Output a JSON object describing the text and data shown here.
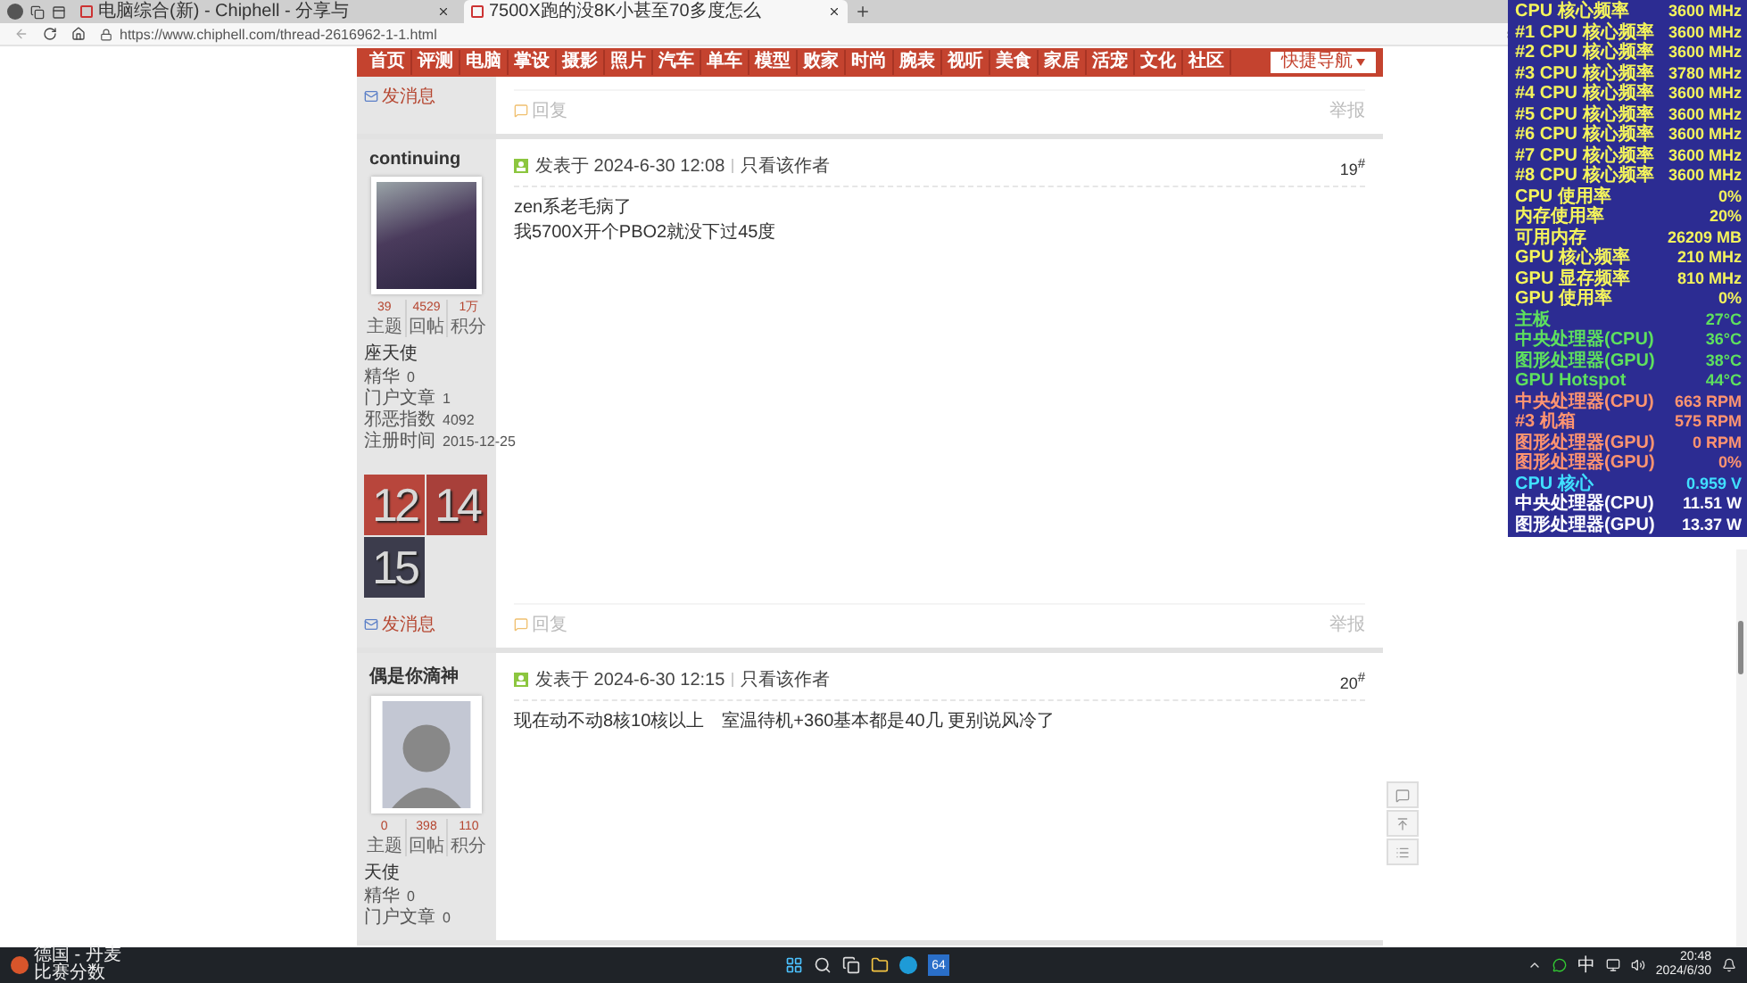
{
  "browser": {
    "tabs": [
      {
        "title": "电脑综合(新) - Chiphell - 分享与",
        "selected": false
      },
      {
        "title": "7500X跑的没8K小甚至70多度怎么",
        "selected": true
      }
    ],
    "url": "https://www.chiphell.com/thread-2616962-1-1.html"
  },
  "nav": {
    "items": [
      "首页",
      "评测",
      "电脑",
      "掌设",
      "摄影",
      "照片",
      "汽车",
      "单车",
      "模型",
      "败家",
      "时尚",
      "腕表",
      "视听",
      "美食",
      "家居",
      "活宠",
      "文化",
      "社区"
    ],
    "quick_nav": "快捷导航"
  },
  "previous_post": {
    "message_link": "发消息",
    "reply": "回复",
    "report": "举报"
  },
  "posts": [
    {
      "author": "continuing",
      "avatar": {
        "kind": "photo"
      },
      "stats": [
        {
          "value": "39",
          "label": "主题"
        },
        {
          "value": "4529",
          "label": "回帖"
        },
        {
          "value": "1万",
          "label": "积分"
        }
      ],
      "rank": "座天使",
      "info": [
        {
          "label": "精华",
          "value": "0"
        },
        {
          "label": "门户文章",
          "value": "1"
        },
        {
          "label": "邪恶指数",
          "value": "4092"
        },
        {
          "label": "注册时间",
          "value": "2015-12-25"
        }
      ],
      "medals": [
        {
          "text": "12",
          "color": "#b8463c"
        },
        {
          "text": "14",
          "color": "#a8403a"
        },
        {
          "text": "15",
          "color": "#3c3c4c"
        }
      ],
      "message_link": "发消息",
      "posted": "发表于 2024-6-30 12:08",
      "only_author": "只看该作者",
      "floor": "19$^{#}$",
      "content": [
        "zen系老毛病了",
        "我5700X开个PBO2就没下过45度"
      ],
      "reply": "回复",
      "report": "举报"
    },
    {
      "author": "偶是你滴神",
      "avatar": {
        "kind": "cartoon"
      },
      "stats": [
        {
          "value": "0",
          "label": "主题"
        },
        {
          "value": "398",
          "label": "回帖"
        },
        {
          "value": "110",
          "label": "积分"
        }
      ],
      "rank": "天使",
      "info": [
        {
          "label": "精华",
          "value": "0"
        },
        {
          "label": "门户文章",
          "value": "0"
        }
      ],
      "posted": "发表于 2024-6-30 12:15",
      "only_author": "只看该作者",
      "floor": "20$^{#}$",
      "content": [
        "现在动不动8核10核以上　室温待机+360基本都是40几 更别说风冷了"
      ]
    }
  ],
  "monitor": [
    {
      "label": "CPU 核心频率",
      "value": "3600 MHz",
      "color": "#f4f45c"
    },
    {
      "label": "#1 CPU 核心频率",
      "value": "3600 MHz",
      "color": "#f4f45c"
    },
    {
      "label": "#2 CPU 核心频率",
      "value": "3600 MHz",
      "color": "#f4f45c"
    },
    {
      "label": "#3 CPU 核心频率",
      "value": "3780 MHz",
      "color": "#f4f45c"
    },
    {
      "label": "#4 CPU 核心频率",
      "value": "3600 MHz",
      "color": "#f4f45c"
    },
    {
      "label": "#5 CPU 核心频率",
      "value": "3600 MHz",
      "color": "#f4f45c"
    },
    {
      "label": "#6 CPU 核心频率",
      "value": "3600 MHz",
      "color": "#f4f45c"
    },
    {
      "label": "#7 CPU 核心频率",
      "value": "3600 MHz",
      "color": "#f4f45c"
    },
    {
      "label": "#8 CPU 核心频率",
      "value": "3600 MHz",
      "color": "#f4f45c"
    },
    {
      "label": "CPU 使用率",
      "value": "0%",
      "color": "#f4f45c"
    },
    {
      "label": "内存使用率",
      "value": "20%",
      "color": "#f4f45c"
    },
    {
      "label": "可用内存",
      "value": "26209 MB",
      "color": "#f4f45c"
    },
    {
      "label": "GPU 核心频率",
      "value": "210 MHz",
      "color": "#f4f45c"
    },
    {
      "label": "GPU 显存频率",
      "value": "810 MHz",
      "color": "#f4f45c"
    },
    {
      "label": "GPU 使用率",
      "value": "0%",
      "color": "#f4f45c"
    },
    {
      "label": "主板",
      "value": "27°C",
      "color": "#5ee05e"
    },
    {
      "label": "中央处理器(CPU)",
      "value": "36°C",
      "color": "#5ee05e"
    },
    {
      "label": "图形处理器(GPU)",
      "value": "38°C",
      "color": "#5ee05e"
    },
    {
      "label": "GPU Hotspot",
      "value": "44°C",
      "color": "#5ee05e"
    },
    {
      "label": "中央处理器(CPU)",
      "value": "663 RPM",
      "color": "#ff9470"
    },
    {
      "label": "#3 机箱",
      "value": "575 RPM",
      "color": "#ff9470"
    },
    {
      "label": "图形处理器(GPU)",
      "value": "0 RPM",
      "color": "#ff9470"
    },
    {
      "label": "图形处理器(GPU)",
      "value": "0%",
      "color": "#ff9470"
    },
    {
      "label": "CPU 核心",
      "value": "0.959 V",
      "color": "#40e0ff"
    },
    {
      "label": "中央处理器(CPU)",
      "value": "11.51 W",
      "color": "#ffffff"
    },
    {
      "label": "图形处理器(GPU)",
      "value": "13.37 W",
      "color": "#ffffff"
    }
  ],
  "taskbar": {
    "weather_title": "德国 - 丹麦",
    "weather_sub": "比赛分数",
    "app_label": "64",
    "ime": "中",
    "time": "20:48",
    "date": "2024/6/30"
  }
}
